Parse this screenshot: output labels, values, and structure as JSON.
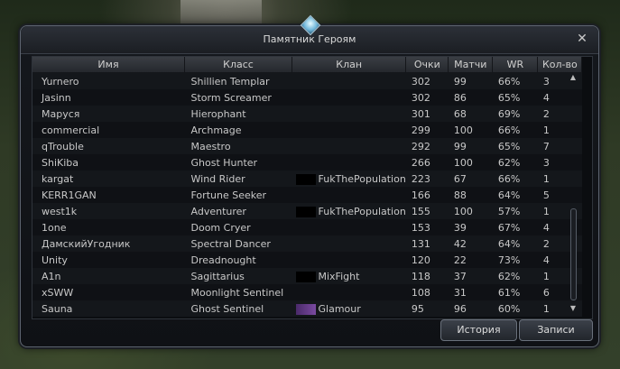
{
  "window": {
    "title": "Памятник Героям",
    "close_label": "✕"
  },
  "table": {
    "headers": [
      "Имя",
      "Класс",
      "Клан",
      "Очки",
      "Матчи",
      "WR",
      "Кол-во"
    ],
    "rows": [
      {
        "name": "Yurnero",
        "class": "Shillien Templar",
        "clan": "",
        "points": "302",
        "matches": "99",
        "wr": "66%",
        "count": "3"
      },
      {
        "name": "Jasinn",
        "class": "Storm Screamer",
        "clan": "",
        "points": "302",
        "matches": "86",
        "wr": "65%",
        "count": "4"
      },
      {
        "name": "Маруся",
        "class": "Hierophant",
        "clan": "",
        "points": "301",
        "matches": "68",
        "wr": "69%",
        "count": "2"
      },
      {
        "name": "commercial",
        "class": "Archmage",
        "clan": "",
        "points": "299",
        "matches": "100",
        "wr": "66%",
        "count": "1"
      },
      {
        "name": "qTrouble",
        "class": "Maestro",
        "clan": "",
        "points": "292",
        "matches": "99",
        "wr": "65%",
        "count": "7"
      },
      {
        "name": "ShiKiba",
        "class": "Ghost Hunter",
        "clan": "",
        "points": "266",
        "matches": "100",
        "wr": "62%",
        "count": "3"
      },
      {
        "name": "kargat",
        "class": "Wind Rider",
        "clan": "FukThePopulation",
        "points": "223",
        "matches": "67",
        "wr": "66%",
        "count": "1"
      },
      {
        "name": "KERR1GAN",
        "class": "Fortune Seeker",
        "clan": "",
        "points": "166",
        "matches": "88",
        "wr": "64%",
        "count": "5"
      },
      {
        "name": "west1k",
        "class": "Adventurer",
        "clan": "FukThePopulation",
        "points": "155",
        "matches": "100",
        "wr": "57%",
        "count": "1"
      },
      {
        "name": "1one",
        "class": "Doom Cryer",
        "clan": "",
        "points": "153",
        "matches": "39",
        "wr": "67%",
        "count": "4"
      },
      {
        "name": "ДамскийУгодник",
        "class": "Spectral Dancer",
        "clan": "",
        "points": "131",
        "matches": "42",
        "wr": "64%",
        "count": "2"
      },
      {
        "name": "Unity",
        "class": "Dreadnought",
        "clan": "",
        "points": "120",
        "matches": "22",
        "wr": "73%",
        "count": "4"
      },
      {
        "name": "A1n",
        "class": "Sagittarius",
        "clan": "MixFight",
        "points": "118",
        "matches": "37",
        "wr": "62%",
        "count": "1"
      },
      {
        "name": "xSWW",
        "class": "Moonlight Sentinel",
        "clan": "",
        "points": "108",
        "matches": "31",
        "wr": "61%",
        "count": "6"
      },
      {
        "name": "Sauna",
        "class": "Ghost Sentinel",
        "clan": "Glamour",
        "points": "95",
        "matches": "96",
        "wr": "60%",
        "count": "1"
      }
    ]
  },
  "buttons": {
    "history": "История",
    "records": "Записи"
  }
}
